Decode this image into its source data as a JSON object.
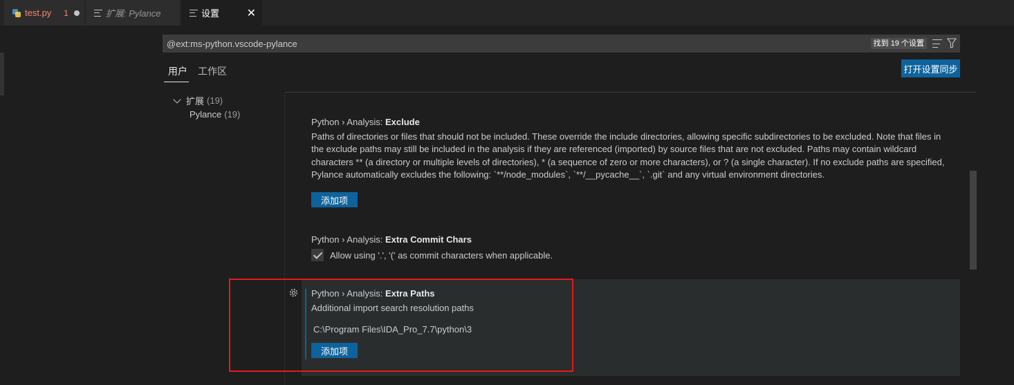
{
  "tabs": [
    {
      "label": "test.py",
      "problems": "1"
    },
    {
      "label": "扩展: Pylance"
    },
    {
      "label": "设置"
    }
  ],
  "search": {
    "query": "@ext:ms-python.vscode-pylance",
    "result_count": "找到 19 个设置"
  },
  "scope_tabs": {
    "user": "用户",
    "workspace": "工作区"
  },
  "sync_button": "打开设置同步",
  "toc": {
    "extensions": {
      "label": "扩展",
      "count": "(19)"
    },
    "pylance": {
      "label": "Pylance",
      "count": "(19)"
    }
  },
  "settings": {
    "exclude": {
      "category": "Python › Analysis: ",
      "name": "Exclude",
      "description": "Paths of directories or files that should not be included. These override the include directories, allowing specific subdirectories to be excluded. Note that files in the exclude paths may still be included in the analysis if they are referenced (imported) by source files that are not excluded. Paths may contain wildcard characters ** (a directory or multiple levels of directories), * (a sequence of zero or more characters), or ? (a single character). If no exclude paths are specified, Pylance automatically excludes the following: `**/node_modules`, `**/__pycache__`, `.git` and any virtual environment directories.",
      "add_label": "添加项"
    },
    "extra_commit_chars": {
      "category": "Python › Analysis: ",
      "name": "Extra Commit Chars",
      "checkbox_label": "Allow using '.', '(' as commit characters when applicable.",
      "checked": true
    },
    "extra_paths": {
      "category": "Python › Analysis: ",
      "name": "Extra Paths",
      "description": "Additional import search resolution paths",
      "items": [
        "C:\\Program Files\\IDA_Pro_7.7\\python\\3"
      ],
      "add_label": "添加项"
    }
  },
  "colors": {
    "accent": "#0e639c",
    "highlight_box": "#e51a1a",
    "modified_tab": "#f48771"
  },
  "icons": [
    "python-file-icon",
    "settings-editor-icon",
    "close-icon",
    "clear-filter-icon",
    "filter-icon",
    "chevron-down-icon",
    "gear-icon",
    "check-icon"
  ]
}
